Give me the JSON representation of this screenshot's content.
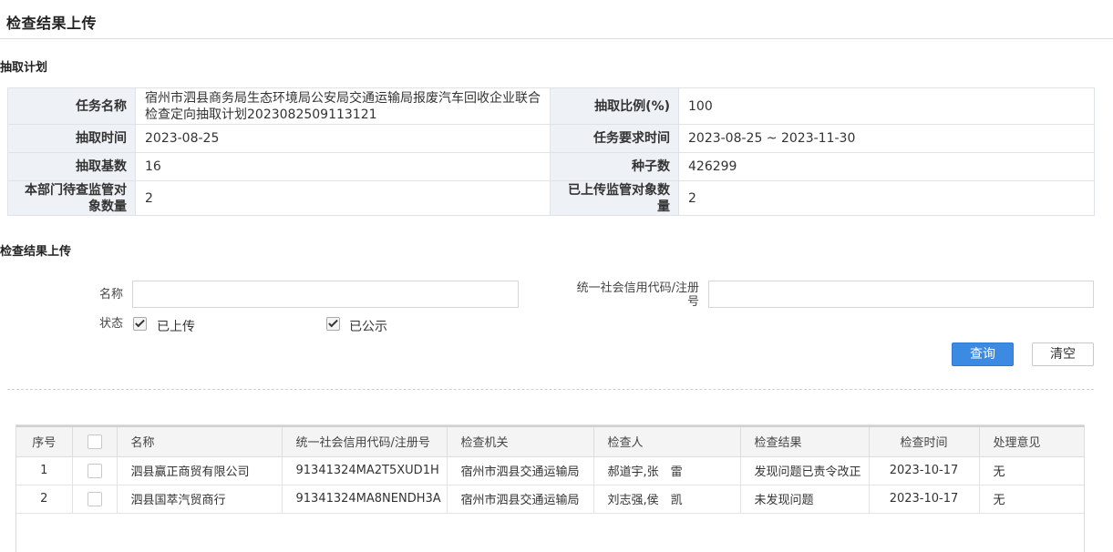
{
  "page": {
    "title": "检查结果上传"
  },
  "plan_section": {
    "title": "抽取计划",
    "rows": [
      [
        {
          "label": "任务名称",
          "value": "宿州市泗县商务局生态环境局公安局交通运输局报废汽车回收企业联合检查定向抽取计划2023082509113121"
        },
        {
          "label": "抽取比例(%)",
          "value": "100"
        }
      ],
      [
        {
          "label": "抽取时间",
          "value": "2023-08-25"
        },
        {
          "label": "任务要求时间",
          "value": "2023-08-25 ~ 2023-11-30"
        }
      ],
      [
        {
          "label": "抽取基数",
          "value": "16"
        },
        {
          "label": "种子数",
          "value": "426299"
        }
      ],
      [
        {
          "label": "本部门待查监管对象数量",
          "value": "2"
        },
        {
          "label": "已上传监管对象数量",
          "value": "2"
        }
      ]
    ]
  },
  "upload_section": {
    "title": "检查结果上传"
  },
  "filters": {
    "name_label": "名称",
    "name_value": "",
    "credit_label": "统一社会信用代码/注册号",
    "credit_value": "",
    "status_label": "状态",
    "status_options": [
      {
        "label": "已上传",
        "checked": true
      },
      {
        "label": "已公示",
        "checked": true
      }
    ],
    "query_button": "查询",
    "clear_button": "清空"
  },
  "grid": {
    "columns": [
      "序号",
      "",
      "名称",
      "统一社会信用代码/注册号",
      "检查机关",
      "检查人",
      "检查结果",
      "检查时间",
      "处理意见"
    ],
    "rows": [
      [
        "1",
        "",
        "泗县赢正商贸有限公司",
        "91341324MA2T5XUD1H",
        "宿州市泗县交通运输局",
        "郝道宇,张　雷",
        "发现问题已责令改正",
        "2023-10-17",
        "无"
      ],
      [
        "2",
        "",
        "泗县国萃汽贸商行",
        "91341324MA8NENDH3A",
        "宿州市泗县交通运输局",
        "刘志强,侯　凯",
        "未发现问题",
        "2023-10-17",
        "无"
      ]
    ]
  },
  "colors": {
    "accent": "#3d8ae2",
    "label_bg": "#eef1f5",
    "header_bg": "#f4f4f4"
  }
}
